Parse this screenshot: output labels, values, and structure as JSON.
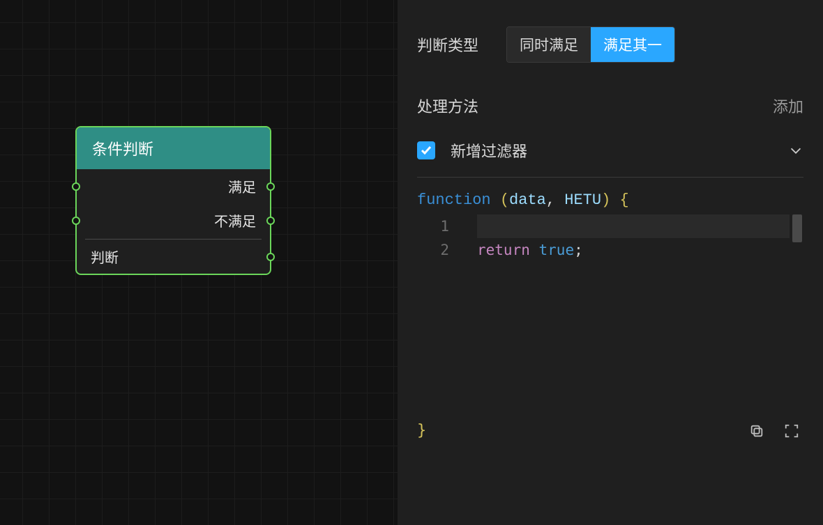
{
  "node": {
    "title": "条件判断",
    "rows": [
      "满足",
      "不满足"
    ],
    "bottom": "判断"
  },
  "panel": {
    "judgeTypeLabel": "判断类型",
    "segOptions": {
      "all": "同时满足",
      "any": "满足其一"
    },
    "segActive": "any",
    "methodLabel": "处理方法",
    "addLabel": "添加",
    "filter": {
      "checked": true,
      "label": "新增过滤器"
    },
    "code": {
      "headerParts": {
        "fn": "function",
        "open": "(",
        "arg1": "data",
        "comma": ",",
        "arg2": "HETU",
        "close": ") {"
      },
      "lines": [
        {
          "num": "1",
          "text": ""
        },
        {
          "num": "2",
          "ret": "return",
          "val": "true",
          "semi": ";"
        }
      ],
      "footerBrace": "}"
    }
  }
}
